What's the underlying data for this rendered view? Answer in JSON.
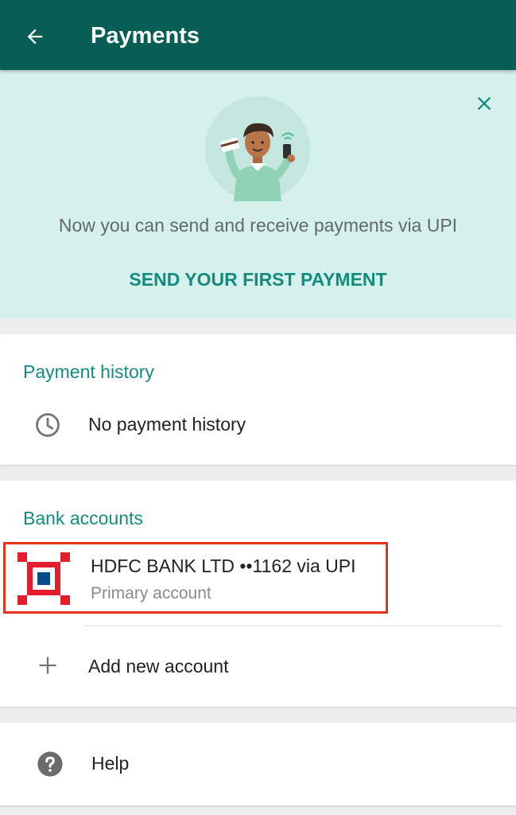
{
  "appbar": {
    "title": "Payments",
    "color": "#075e54"
  },
  "banner": {
    "message": "Now you can send and receive payments via UPI",
    "cta_label": "SEND YOUR FIRST PAYMENT",
    "background": "#d6f0eb",
    "accent": "#128c7e"
  },
  "payment_history": {
    "title": "Payment history",
    "empty_text": "No payment history",
    "icon": "clock-icon"
  },
  "bank_accounts": {
    "title": "Bank accounts",
    "accounts": [
      {
        "name": "HDFC BANK LTD ••1162 via UPI",
        "subtitle": "Primary account",
        "icon": "hdfc-bank-logo"
      }
    ],
    "add_label": "Add new account",
    "add_icon": "plus-icon"
  },
  "help": {
    "label": "Help",
    "icon": "help-icon"
  }
}
